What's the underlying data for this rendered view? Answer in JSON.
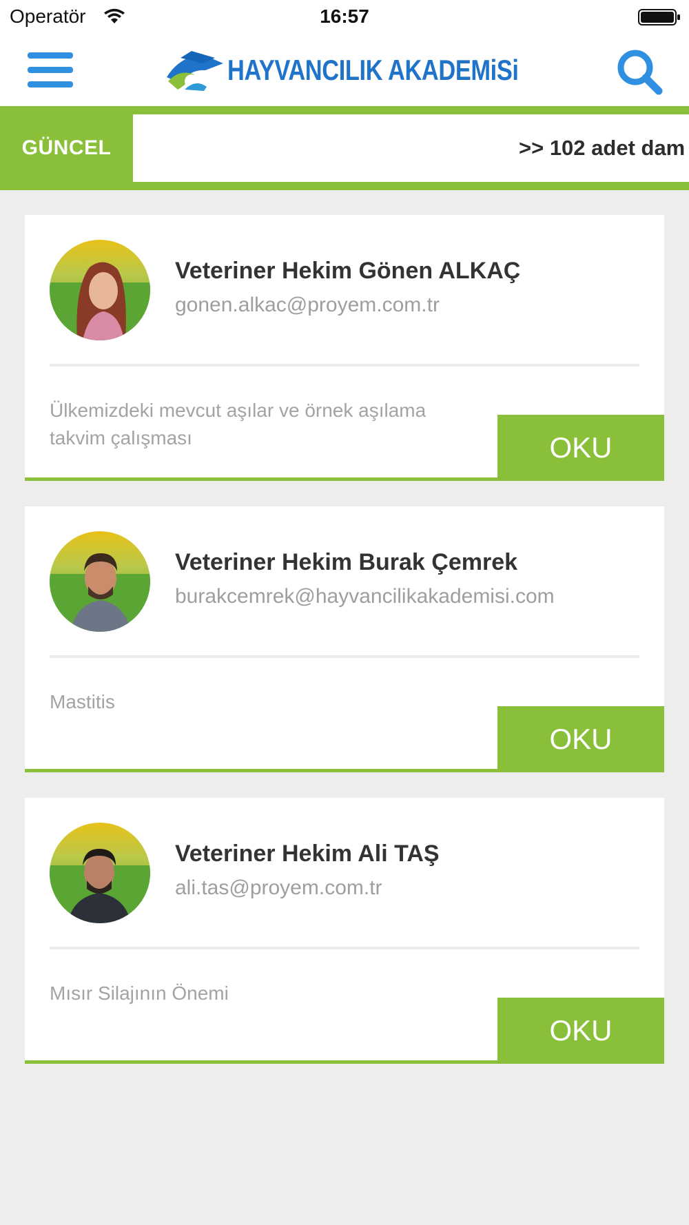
{
  "status_bar": {
    "carrier": "Operatör",
    "time": "16:57"
  },
  "header": {
    "logo_text": "HAYVANCILIK AKADEMiSi"
  },
  "ticker": {
    "label": "GÜNCEL",
    "text": ">> 102 adet dam"
  },
  "cards": [
    {
      "name": "Veteriner Hekim Gönen ALKAÇ",
      "email": "gonen.alkac@proyem.com.tr",
      "article": "Ülkemizdeki mevcut aşılar ve örnek aşılama takvim çalışması",
      "button": "OKU"
    },
    {
      "name": "Veteriner Hekim Burak Çemrek",
      "email": "burakcemrek@hayvancilikakademisi.com",
      "article": "Mastitis",
      "button": "OKU"
    },
    {
      "name": "Veteriner Hekim Ali TAŞ",
      "email": "ali.tas@proyem.com.tr",
      "article": "Mısır Silajının Önemi",
      "button": "OKU"
    }
  ],
  "colors": {
    "accent_green": "#8abf3a",
    "brand_blue": "#1f73c9",
    "icon_blue": "#2f8fe0",
    "background": "#ededed"
  },
  "icons": [
    "wifi-icon",
    "battery-icon",
    "menu-icon",
    "logo-icon",
    "search-icon"
  ]
}
